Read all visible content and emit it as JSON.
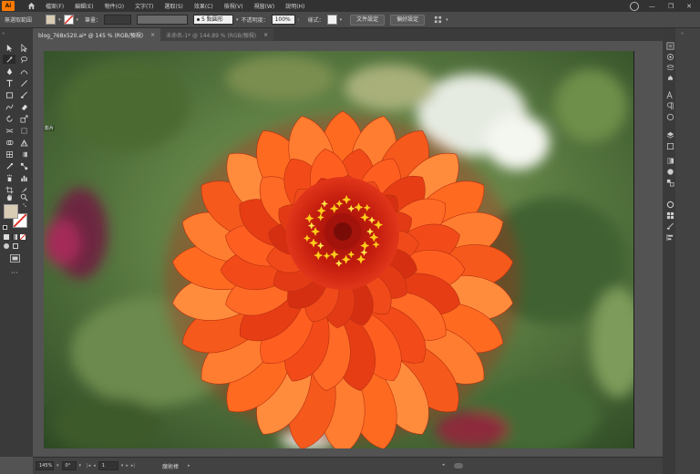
{
  "menubar": {
    "logo": "Ai",
    "items": [
      "檔案(F)",
      "編輯(E)",
      "物件(O)",
      "文字(T)",
      "選取(S)",
      "效果(C)",
      "檢視(V)",
      "視窗(W)",
      "說明(H)"
    ]
  },
  "controlbar": {
    "selection_label": "無選取範圍",
    "stroke_label": "筆畫：",
    "brush_value": "5 點圓形",
    "opacity_label": "不透明度：",
    "opacity_value": "100%",
    "style_label": "樣式：",
    "doc_setup_button": "文件設定",
    "preferences_button": "偏好設定"
  },
  "tabs": [
    {
      "label": "blog_768x520.ai* @ 145 % (RGB/預視)",
      "close": "×"
    },
    {
      "label": "未命名-1* @ 144.89 % (RGB/預視)",
      "close": "×"
    }
  ],
  "statusbar": {
    "zoom": "145%",
    "rotation": "0°",
    "artboard_number": "1",
    "tool_name": "魔術棒"
  },
  "artboard_label": "影片",
  "colors": {
    "fill": "#d9ccb4",
    "accent": "#ff7a00",
    "petal_dark": "#d93a12",
    "petal_mid": "#ff5a1e",
    "petal_light": "#ff8a3c",
    "center_yellow": "#ffd21e",
    "background_green": "#5e7f44"
  },
  "icons": {
    "home": "home-icon",
    "selection": "selection-tool-icon",
    "direct_selection": "direct-selection-tool-icon",
    "magic_wand": "magic-wand-tool-icon",
    "pen": "pen-tool-icon",
    "type": "type-tool-icon",
    "line": "line-tool-icon",
    "rectangle": "rectangle-tool-icon",
    "brush": "paintbrush-tool-icon",
    "eraser": "eraser-tool-icon",
    "rotate": "rotate-tool-icon",
    "hand": "hand-tool-icon",
    "zoom": "zoom-tool-icon"
  }
}
